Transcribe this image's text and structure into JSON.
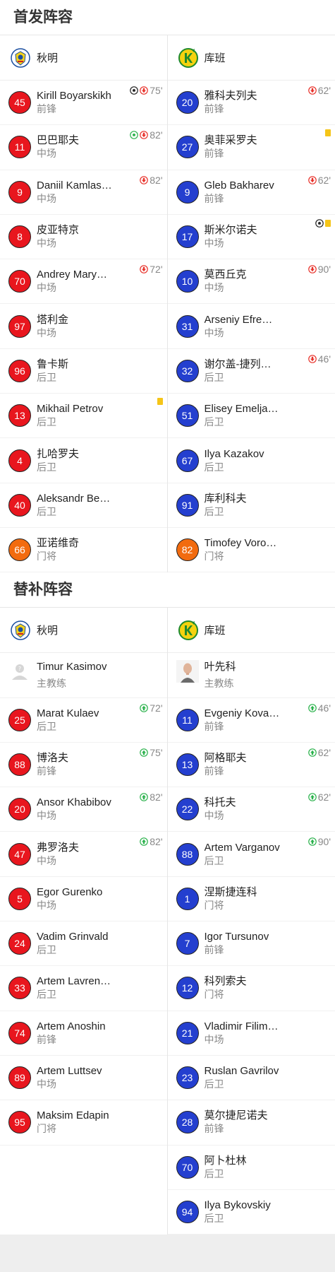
{
  "sections": {
    "starting_title": "首发阵容",
    "subs_title": "替补阵容"
  },
  "teams": {
    "home": "秋明",
    "away": "库班"
  },
  "colors": {
    "home_badge": "#e8161e",
    "away_badge": "#243fcf",
    "goalkeeper_badge": "#f26b0f",
    "yellow_card": "#f5c518",
    "sub_out": "#e8312a",
    "sub_in": "#2bb24c"
  },
  "starting": {
    "home": [
      {
        "num": "45",
        "name": "Kirill Boyarskikh",
        "pos": "前锋",
        "badge": "red",
        "events": [
          "goal-ball-icon",
          "sub-out-icon"
        ],
        "minute": "75'"
      },
      {
        "num": "11",
        "name": "巴巴耶夫",
        "pos": "中场",
        "badge": "red",
        "events": [
          "goal-green-icon",
          "sub-out-icon"
        ],
        "minute": "82'"
      },
      {
        "num": "9",
        "name": "Daniil Kamlas…",
        "pos": "中场",
        "badge": "red",
        "events": [
          "sub-out-icon"
        ],
        "minute": "82'"
      },
      {
        "num": "8",
        "name": "皮亚特京",
        "pos": "中场",
        "badge": "red",
        "events": [],
        "minute": ""
      },
      {
        "num": "70",
        "name": "Andrey Mary…",
        "pos": "中场",
        "badge": "red",
        "events": [
          "sub-out-icon"
        ],
        "minute": "72'"
      },
      {
        "num": "97",
        "name": "塔利金",
        "pos": "中场",
        "badge": "red",
        "events": [],
        "minute": ""
      },
      {
        "num": "96",
        "name": "鲁卡斯",
        "pos": "后卫",
        "badge": "red",
        "events": [],
        "minute": ""
      },
      {
        "num": "13",
        "name": "Mikhail Petrov",
        "pos": "后卫",
        "badge": "red",
        "events": [
          "yellow-card-icon"
        ],
        "minute": ""
      },
      {
        "num": "4",
        "name": "扎哈罗夫",
        "pos": "后卫",
        "badge": "red",
        "events": [],
        "minute": ""
      },
      {
        "num": "40",
        "name": "Aleksandr Be…",
        "pos": "后卫",
        "badge": "red",
        "events": [],
        "minute": ""
      },
      {
        "num": "66",
        "name": "亚诺维奇",
        "pos": "门将",
        "badge": "orange",
        "events": [],
        "minute": ""
      }
    ],
    "away": [
      {
        "num": "20",
        "name": "雅科夫列夫",
        "pos": "前锋",
        "badge": "blue",
        "events": [
          "sub-out-icon"
        ],
        "minute": "62'"
      },
      {
        "num": "27",
        "name": "奥菲采罗夫",
        "pos": "前锋",
        "badge": "blue",
        "events": [
          "yellow-card-icon"
        ],
        "minute": ""
      },
      {
        "num": "9",
        "name": "Gleb Bakharev",
        "pos": "前锋",
        "badge": "blue",
        "events": [
          "sub-out-icon"
        ],
        "minute": "62'"
      },
      {
        "num": "17",
        "name": "斯米尔诺夫",
        "pos": "中场",
        "badge": "blue",
        "events": [
          "goal-ball-icon",
          "yellow-card-icon"
        ],
        "minute": ""
      },
      {
        "num": "10",
        "name": "莫西丘克",
        "pos": "中场",
        "badge": "blue",
        "events": [
          "sub-out-icon"
        ],
        "minute": "90'"
      },
      {
        "num": "31",
        "name": "Arseniy Efre…",
        "pos": "中场",
        "badge": "blue",
        "events": [],
        "minute": ""
      },
      {
        "num": "32",
        "name": "谢尔盖-捷列…",
        "pos": "后卫",
        "badge": "blue",
        "events": [
          "sub-out-icon"
        ],
        "minute": "46'"
      },
      {
        "num": "51",
        "name": "Elisey Emelja…",
        "pos": "后卫",
        "badge": "blue",
        "events": [],
        "minute": ""
      },
      {
        "num": "67",
        "name": "Ilya Kazakov",
        "pos": "后卫",
        "badge": "blue",
        "events": [],
        "minute": ""
      },
      {
        "num": "91",
        "name": "库利科夫",
        "pos": "后卫",
        "badge": "blue",
        "events": [],
        "minute": ""
      },
      {
        "num": "82",
        "name": "Timofey Voro…",
        "pos": "门将",
        "badge": "orange",
        "events": [],
        "minute": ""
      }
    ]
  },
  "subs": {
    "home_coach": {
      "name": "Timur Kasimov",
      "role": "主教练",
      "avatar": "placeholder-avatar-icon"
    },
    "away_coach": {
      "name": "叶先科",
      "role": "主教练",
      "avatar": "coach-photo-icon"
    },
    "home": [
      {
        "num": "25",
        "name": "Marat Kulaev",
        "pos": "后卫",
        "badge": "red",
        "events": [
          "sub-in-icon"
        ],
        "minute": "72'"
      },
      {
        "num": "88",
        "name": "博洛夫",
        "pos": "前锋",
        "badge": "red",
        "events": [
          "sub-in-icon"
        ],
        "minute": "75'"
      },
      {
        "num": "20",
        "name": "Ansor Khabibov",
        "pos": "中场",
        "badge": "red",
        "events": [
          "sub-in-icon"
        ],
        "minute": "82'"
      },
      {
        "num": "47",
        "name": "弗罗洛夫",
        "pos": "中场",
        "badge": "red",
        "events": [
          "sub-in-icon"
        ],
        "minute": "82'"
      },
      {
        "num": "5",
        "name": "Egor Gurenko",
        "pos": "中场",
        "badge": "red",
        "events": [],
        "minute": ""
      },
      {
        "num": "24",
        "name": "Vadim Grinvald",
        "pos": "后卫",
        "badge": "red",
        "events": [],
        "minute": ""
      },
      {
        "num": "33",
        "name": "Artem Lavren…",
        "pos": "后卫",
        "badge": "red",
        "events": [],
        "minute": ""
      },
      {
        "num": "74",
        "name": "Artem Anoshin",
        "pos": "前锋",
        "badge": "red",
        "events": [],
        "minute": ""
      },
      {
        "num": "89",
        "name": "Artem Luttsev",
        "pos": "中场",
        "badge": "red",
        "events": [],
        "minute": ""
      },
      {
        "num": "95",
        "name": "Maksim Edapin",
        "pos": "门将",
        "badge": "red",
        "events": [],
        "minute": ""
      }
    ],
    "away": [
      {
        "num": "11",
        "name": "Evgeniy Kova…",
        "pos": "前锋",
        "badge": "blue",
        "events": [
          "sub-in-icon"
        ],
        "minute": "46'"
      },
      {
        "num": "13",
        "name": "阿格耶夫",
        "pos": "前锋",
        "badge": "blue",
        "events": [
          "sub-in-icon"
        ],
        "minute": "62'"
      },
      {
        "num": "22",
        "name": "科托夫",
        "pos": "中场",
        "badge": "blue",
        "events": [
          "sub-in-icon"
        ],
        "minute": "62'"
      },
      {
        "num": "88",
        "name": "Artem Varganov",
        "pos": "后卫",
        "badge": "blue",
        "events": [
          "sub-in-icon"
        ],
        "minute": "90'"
      },
      {
        "num": "1",
        "name": "涅斯捷连科",
        "pos": "门将",
        "badge": "blue",
        "events": [],
        "minute": ""
      },
      {
        "num": "7",
        "name": "Igor Tursunov",
        "pos": "前锋",
        "badge": "blue",
        "events": [],
        "minute": ""
      },
      {
        "num": "12",
        "name": "科列索夫",
        "pos": "门将",
        "badge": "blue",
        "events": [],
        "minute": ""
      },
      {
        "num": "21",
        "name": "Vladimir Filim…",
        "pos": "中场",
        "badge": "blue",
        "events": [],
        "minute": ""
      },
      {
        "num": "23",
        "name": "Ruslan Gavrilov",
        "pos": "后卫",
        "badge": "blue",
        "events": [],
        "minute": ""
      },
      {
        "num": "28",
        "name": "莫尔捷尼诺夫",
        "pos": "前锋",
        "badge": "blue",
        "events": [],
        "minute": ""
      },
      {
        "num": "70",
        "name": "阿卜杜林",
        "pos": "后卫",
        "badge": "blue",
        "events": [],
        "minute": ""
      },
      {
        "num": "94",
        "name": "Ilya Bykovskiy",
        "pos": "后卫",
        "badge": "blue",
        "events": [],
        "minute": ""
      }
    ]
  }
}
